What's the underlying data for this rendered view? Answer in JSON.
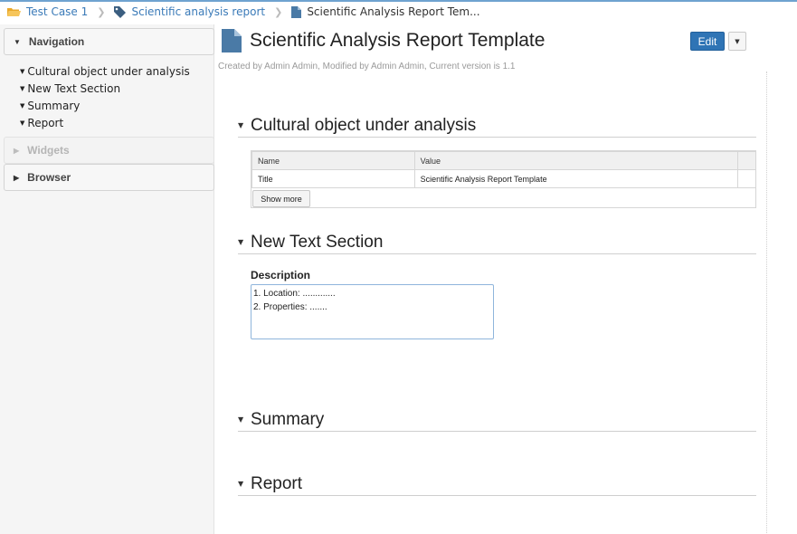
{
  "breadcrumb": {
    "items": [
      "Test Case 1",
      "Scientific analysis report",
      "Scientific Analysis Report Tem..."
    ]
  },
  "sidebar": {
    "navigation_title": "Navigation",
    "nav_items": [
      "Cultural object under analysis",
      "New Text Section",
      "Summary",
      "Report"
    ],
    "widgets_title": "Widgets",
    "browser_title": "Browser"
  },
  "page": {
    "title": "Scientific Analysis Report Template",
    "meta": "Created by Admin Admin, Modified by Admin Admin, Current version is 1.1",
    "edit_label": "Edit"
  },
  "sections": {
    "cultural": "Cultural object under analysis",
    "new_text": "New Text Section",
    "summary": "Summary",
    "report": "Report"
  },
  "table": {
    "columns": [
      "Name",
      "Value"
    ],
    "rows": [
      [
        "Title",
        "Scientific Analysis Report Template"
      ]
    ],
    "show_more": "Show more"
  },
  "description": {
    "label": "Description",
    "lines": [
      "1. Location: .............",
      "2. Properties: ......."
    ]
  },
  "colors": {
    "accent": "#2f74b5",
    "link": "#3a7ab8",
    "folder": "#f0b63c"
  },
  "icons": [
    "folder-icon",
    "tag-icon",
    "document-icon",
    "caret-down-icon",
    "caret-right-icon"
  ]
}
